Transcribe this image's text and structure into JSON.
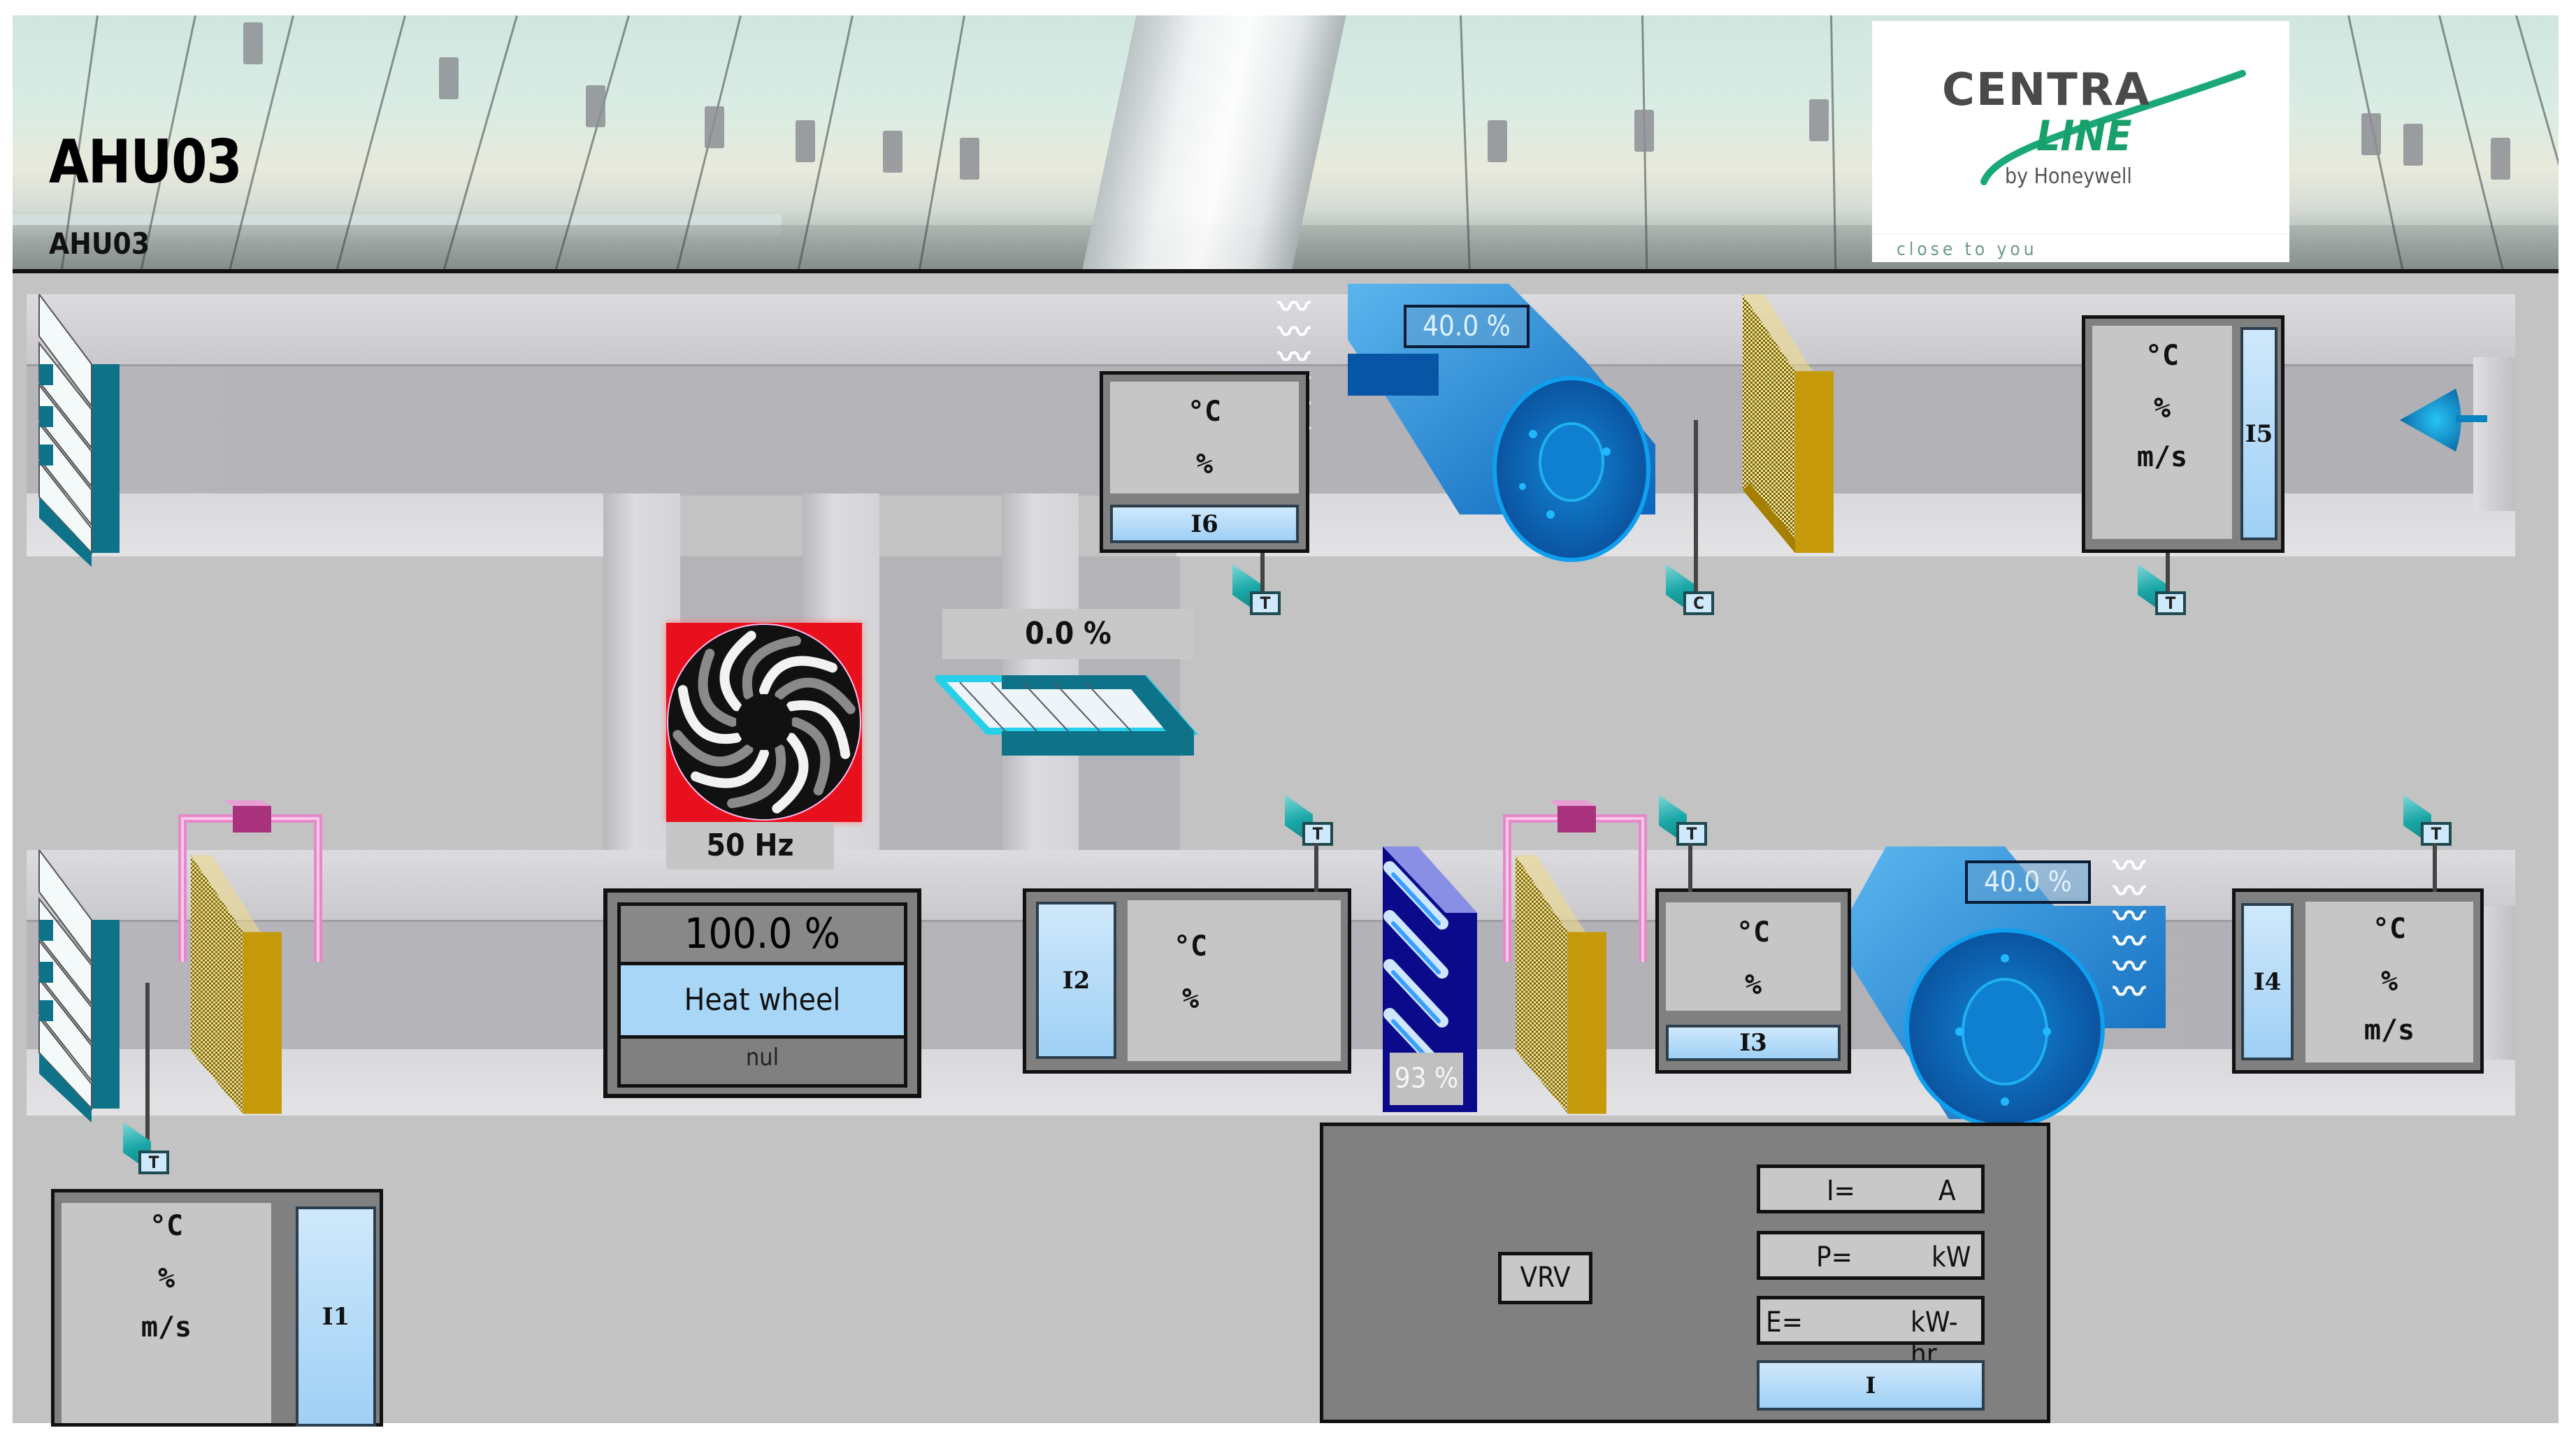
{
  "header": {
    "title": "AHU03",
    "subtitle": "AHU03",
    "logo": {
      "brand_top": "CENTRA",
      "brand_bottom": "LINE",
      "by": "by Honeywell",
      "tagline": "close to you"
    }
  },
  "colors": {
    "canvas_bg": "#c3c3c3",
    "fan_blue": "#0a74c9",
    "heat_wheel_alarm": "#e8101c",
    "damper_teal": "#0e7388",
    "filter_gold": "#c49a0a",
    "coil_navy": "#0a0a8a",
    "humidifier_pink": "#e58ac9",
    "tag_blue": "#a8d6f7"
  },
  "exhaust_fan": {
    "speed_label": "40.0 %",
    "speed_percent": 40.0
  },
  "supply_fan": {
    "speed_label": "40.0 %",
    "speed_percent": 40.0
  },
  "heat_wheel": {
    "frequency": "50 Hz",
    "percent_label": "100.0 %",
    "percent": 100.0,
    "name": "Heat wheel",
    "status": "nul"
  },
  "bypass_damper": {
    "position_label": "0.0 %",
    "position_percent": 0.0
  },
  "cooling_coil": {
    "valve_label": "93 %",
    "valve_percent": 93
  },
  "sensors": {
    "I1": {
      "tag": "I1",
      "units": [
        "°C",
        "%",
        "m/s"
      ]
    },
    "I2": {
      "tag": "I2",
      "units": [
        "°C",
        "%"
      ]
    },
    "I3": {
      "tag": "I3",
      "units": [
        "°C",
        "%"
      ]
    },
    "I4": {
      "tag": "I4",
      "units": [
        "°C",
        "%",
        "m/s"
      ]
    },
    "I5": {
      "tag": "I5",
      "units": [
        "°C",
        "%",
        "m/s"
      ]
    },
    "I6": {
      "tag": "I6",
      "units": [
        "°C",
        "%"
      ]
    }
  },
  "probes": {
    "t_exhaust_i6": "T",
    "c_exhaust": "C",
    "t_exhaust_i5": "T",
    "t_outdoor": "T",
    "t_after_wheel": "T",
    "t_after_coil": "T",
    "t_supply": "T"
  },
  "vrv": {
    "label": "VRV",
    "current": {
      "label": "I=",
      "unit": "A"
    },
    "power": {
      "label": "P=",
      "unit": "kW"
    },
    "energy": {
      "label": "E=",
      "unit": "kW-hr"
    },
    "tag": "I"
  }
}
